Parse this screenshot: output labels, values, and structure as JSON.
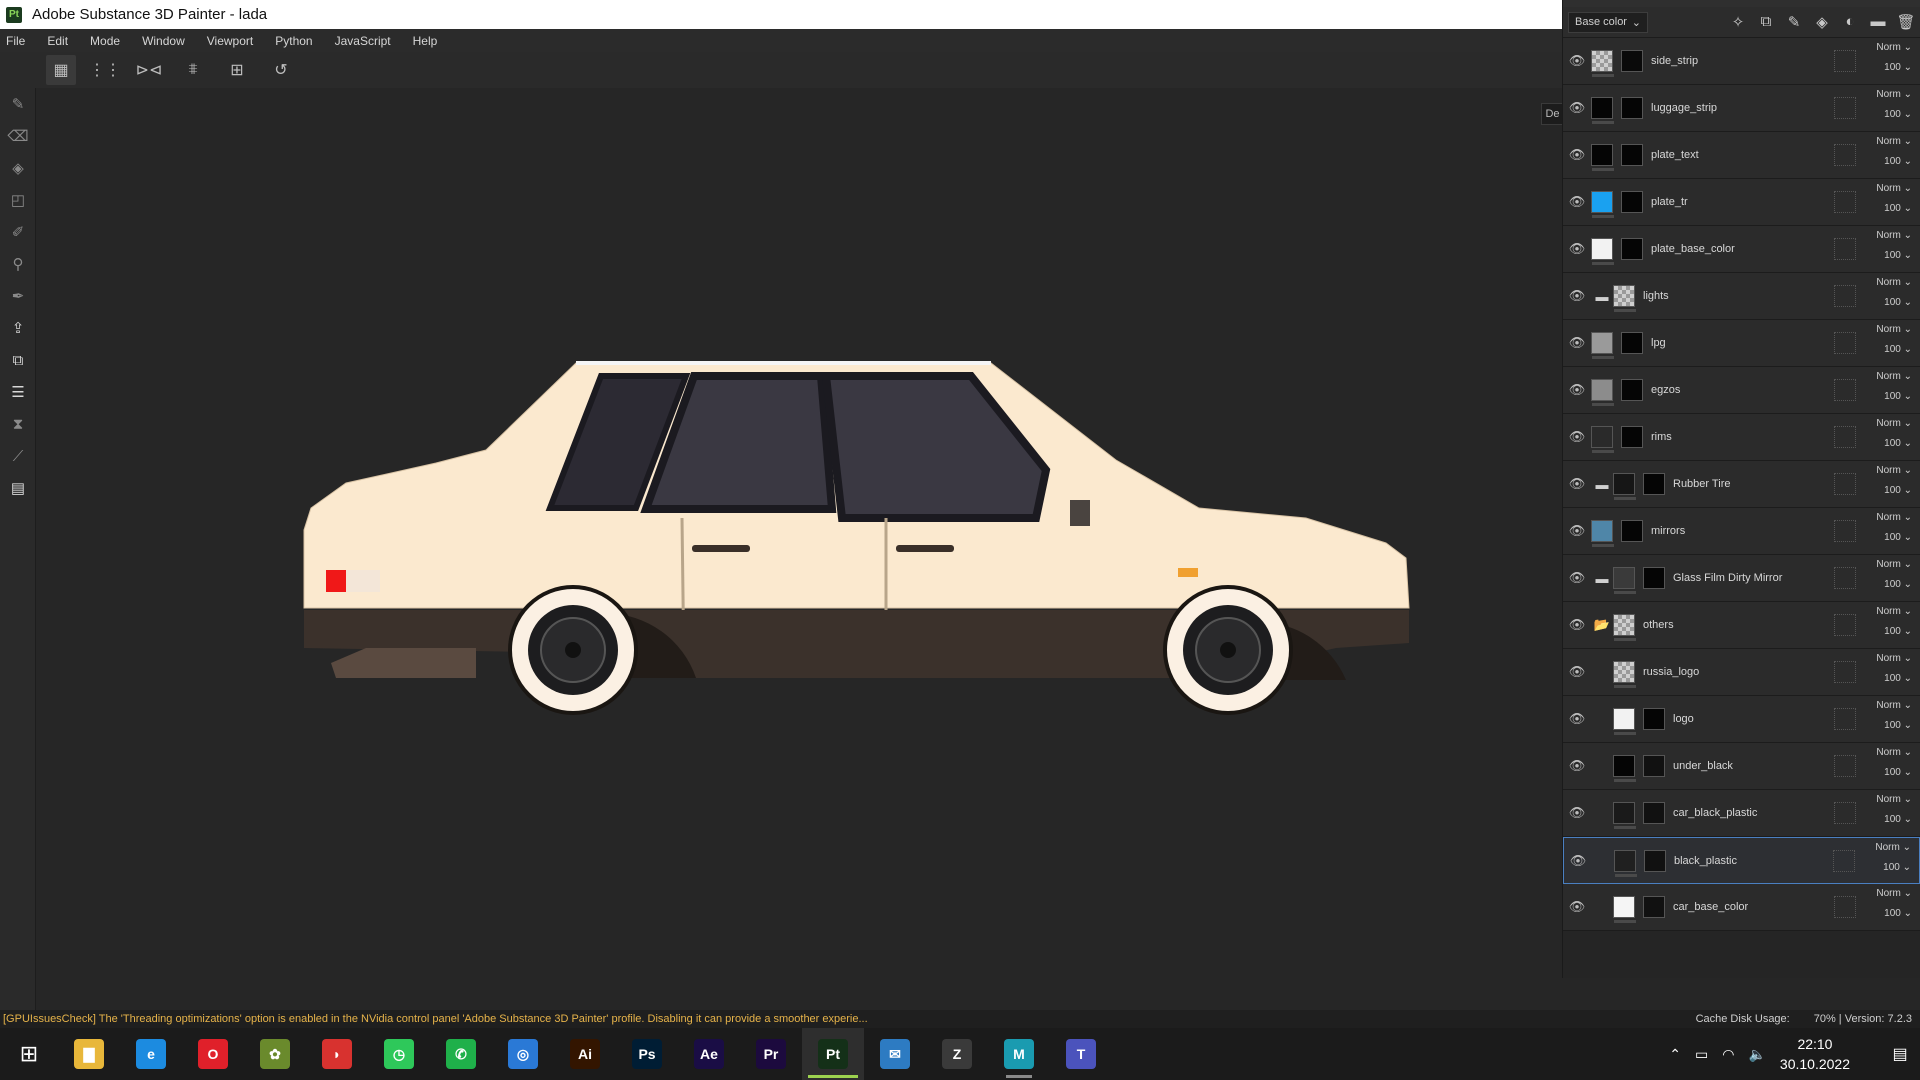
{
  "window": {
    "title": "Adobe Substance 3D Painter - lada",
    "badge": "Pt"
  },
  "menu": [
    "File",
    "Edit",
    "Mode",
    "Window",
    "Viewport",
    "Python",
    "JavaScript",
    "Help"
  ],
  "toolbar_icons": [
    "grid-select-icon",
    "dots-grid-icon",
    "mirror-x-icon",
    "mirror-y-icon",
    "frame-icon",
    "history-icon"
  ],
  "viewport": {
    "side_tab": "De"
  },
  "layers_panel": {
    "channel": "Base color",
    "header_icons": [
      "magic-wand-icon",
      "mask-icon",
      "brush-icon",
      "fill-icon",
      "effect-icon",
      "folder-icon",
      "trash-icon"
    ],
    "layers": [
      {
        "name": "side_strip",
        "blend": "Norm",
        "opacity": "100",
        "folder": false,
        "thumb": "checker",
        "mask": "#0a0a0a"
      },
      {
        "name": "luggage_strip",
        "blend": "Norm",
        "opacity": "100",
        "folder": false,
        "thumb": "#050505",
        "mask": "#050505"
      },
      {
        "name": "plate_text",
        "blend": "Norm",
        "opacity": "100",
        "folder": false,
        "thumb": "#050505",
        "mask": "#050505"
      },
      {
        "name": "plate_tr",
        "blend": "Norm",
        "opacity": "100",
        "folder": false,
        "thumb": "#1aa1f0",
        "mask": "#050505"
      },
      {
        "name": "plate_base_color",
        "blend": "Norm",
        "opacity": "100",
        "folder": false,
        "thumb": "#f2f2f2",
        "mask": "#050505"
      },
      {
        "name": "lights",
        "blend": "Norm",
        "opacity": "100",
        "folder": true,
        "thumb": "checker",
        "mask": null
      },
      {
        "name": "lpg",
        "blend": "Norm",
        "opacity": "100",
        "folder": false,
        "thumb": "#9a9a9a",
        "mask": "#050505"
      },
      {
        "name": "egzos",
        "blend": "Norm",
        "opacity": "100",
        "folder": false,
        "thumb": "#8c8c8c",
        "mask": "#050505"
      },
      {
        "name": "rims",
        "blend": "Norm",
        "opacity": "100",
        "folder": false,
        "thumb": "#2a2a2a",
        "mask": "#050505"
      },
      {
        "name": "Rubber Tire",
        "blend": "Norm",
        "opacity": "100",
        "folder": true,
        "thumb": "#161616",
        "mask": "#050505"
      },
      {
        "name": "mirrors",
        "blend": "Norm",
        "opacity": "100",
        "folder": false,
        "thumb": "#4f86a8",
        "mask": "#050505"
      },
      {
        "name": "Glass Film Dirty Mirror",
        "blend": "Norm",
        "opacity": "100",
        "folder": true,
        "thumb": "#3a3a3a",
        "mask": "#050505"
      },
      {
        "name": "others",
        "blend": "Norm",
        "opacity": "100",
        "folder": true,
        "open": true,
        "thumb": "checker",
        "mask": null
      },
      {
        "name": "russia_logo",
        "blend": "Norm",
        "opacity": "100",
        "folder": false,
        "thumb": "checker",
        "mask": null
      },
      {
        "name": "logo",
        "blend": "Norm",
        "opacity": "100",
        "folder": false,
        "thumb": "#f2f2f2",
        "mask": "#050505"
      },
      {
        "name": "under_black",
        "blend": "Norm",
        "opacity": "100",
        "folder": false,
        "thumb": "#050505",
        "mask": "#111111"
      },
      {
        "name": "car_black_plastic",
        "blend": "Norm",
        "opacity": "100",
        "folder": false,
        "thumb": "#1a1a1a",
        "mask": "#111111"
      },
      {
        "name": "black_plastic",
        "blend": "Norm",
        "opacity": "100",
        "folder": false,
        "thumb": "#202020",
        "mask": "#111111",
        "selected": true
      },
      {
        "name": "car_base_color",
        "blend": "Norm",
        "opacity": "100",
        "folder": false,
        "thumb": "#f5f5f5",
        "mask": "#111111"
      }
    ]
  },
  "status": {
    "warning": "[GPUIssuesCheck] The 'Threading optimizations' option is enabled in the NVidia control panel 'Adobe Substance 3D Painter' profile. Disabling it can provide a smoother experie...",
    "cache_label": "Cache Disk Usage:",
    "cache_value": "70% | Version: 7.2.3"
  },
  "taskbar": {
    "apps": [
      {
        "name": "file-explorer",
        "label": "▇",
        "color": "#e8b73a",
        "running": false
      },
      {
        "name": "edge",
        "label": "e",
        "color": "#1c8be0",
        "running": false
      },
      {
        "name": "opera",
        "label": "O",
        "color": "#e0202a",
        "running": false
      },
      {
        "name": "fruit-app",
        "label": "✿",
        "color": "#6a8a2c",
        "running": false
      },
      {
        "name": "red-app",
        "label": "◗",
        "color": "#d8322f",
        "running": false
      },
      {
        "name": "green-app",
        "label": "◷",
        "color": "#2ec85a",
        "running": false
      },
      {
        "name": "whatsapp",
        "label": "✆",
        "color": "#1fb04a",
        "running": false
      },
      {
        "name": "browser-blue",
        "label": "◎",
        "color": "#2a79d6",
        "running": false
      },
      {
        "name": "illustrator",
        "label": "Ai",
        "color": "#331500",
        "running": false
      },
      {
        "name": "photoshop",
        "label": "Ps",
        "color": "#001d34",
        "running": false
      },
      {
        "name": "after-effects",
        "label": "Ae",
        "color": "#1a0d45",
        "running": false
      },
      {
        "name": "premiere",
        "label": "Pr",
        "color": "#1c0a3e",
        "running": false
      },
      {
        "name": "substance-painter",
        "label": "Pt",
        "color": "#143018",
        "running": true,
        "active": true
      },
      {
        "name": "mail",
        "label": "✉",
        "color": "#2d7bc2",
        "running": false
      },
      {
        "name": "zbrush",
        "label": "Z",
        "color": "#3a3a3a",
        "running": false
      },
      {
        "name": "maya",
        "label": "M",
        "color": "#1a9bb0",
        "running": true
      },
      {
        "name": "teams",
        "label": "T",
        "color": "#4b53bc",
        "running": false
      }
    ],
    "time": "22:10",
    "date": "30.10.2022"
  }
}
